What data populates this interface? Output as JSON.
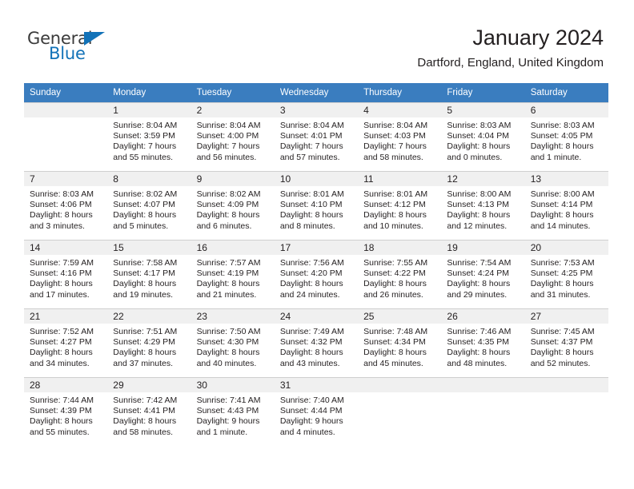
{
  "brand": {
    "name_part1": "General",
    "name_part2": "Blue",
    "accent_color": "#1272b8"
  },
  "header": {
    "title": "January 2024",
    "subtitle": "Dartford, England, United Kingdom"
  },
  "calendar": {
    "header_bg": "#3a7dbf",
    "daynum_bg": "#f0f0f0",
    "weekday_headers": [
      "Sunday",
      "Monday",
      "Tuesday",
      "Wednesday",
      "Thursday",
      "Friday",
      "Saturday"
    ],
    "weeks": [
      [
        {
          "day": "",
          "lines": []
        },
        {
          "day": "1",
          "lines": [
            "Sunrise: 8:04 AM",
            "Sunset: 3:59 PM",
            "Daylight: 7 hours",
            "and 55 minutes."
          ]
        },
        {
          "day": "2",
          "lines": [
            "Sunrise: 8:04 AM",
            "Sunset: 4:00 PM",
            "Daylight: 7 hours",
            "and 56 minutes."
          ]
        },
        {
          "day": "3",
          "lines": [
            "Sunrise: 8:04 AM",
            "Sunset: 4:01 PM",
            "Daylight: 7 hours",
            "and 57 minutes."
          ]
        },
        {
          "day": "4",
          "lines": [
            "Sunrise: 8:04 AM",
            "Sunset: 4:03 PM",
            "Daylight: 7 hours",
            "and 58 minutes."
          ]
        },
        {
          "day": "5",
          "lines": [
            "Sunrise: 8:03 AM",
            "Sunset: 4:04 PM",
            "Daylight: 8 hours",
            "and 0 minutes."
          ]
        },
        {
          "day": "6",
          "lines": [
            "Sunrise: 8:03 AM",
            "Sunset: 4:05 PM",
            "Daylight: 8 hours",
            "and 1 minute."
          ]
        }
      ],
      [
        {
          "day": "7",
          "lines": [
            "Sunrise: 8:03 AM",
            "Sunset: 4:06 PM",
            "Daylight: 8 hours",
            "and 3 minutes."
          ]
        },
        {
          "day": "8",
          "lines": [
            "Sunrise: 8:02 AM",
            "Sunset: 4:07 PM",
            "Daylight: 8 hours",
            "and 5 minutes."
          ]
        },
        {
          "day": "9",
          "lines": [
            "Sunrise: 8:02 AM",
            "Sunset: 4:09 PM",
            "Daylight: 8 hours",
            "and 6 minutes."
          ]
        },
        {
          "day": "10",
          "lines": [
            "Sunrise: 8:01 AM",
            "Sunset: 4:10 PM",
            "Daylight: 8 hours",
            "and 8 minutes."
          ]
        },
        {
          "day": "11",
          "lines": [
            "Sunrise: 8:01 AM",
            "Sunset: 4:12 PM",
            "Daylight: 8 hours",
            "and 10 minutes."
          ]
        },
        {
          "day": "12",
          "lines": [
            "Sunrise: 8:00 AM",
            "Sunset: 4:13 PM",
            "Daylight: 8 hours",
            "and 12 minutes."
          ]
        },
        {
          "day": "13",
          "lines": [
            "Sunrise: 8:00 AM",
            "Sunset: 4:14 PM",
            "Daylight: 8 hours",
            "and 14 minutes."
          ]
        }
      ],
      [
        {
          "day": "14",
          "lines": [
            "Sunrise: 7:59 AM",
            "Sunset: 4:16 PM",
            "Daylight: 8 hours",
            "and 17 minutes."
          ]
        },
        {
          "day": "15",
          "lines": [
            "Sunrise: 7:58 AM",
            "Sunset: 4:17 PM",
            "Daylight: 8 hours",
            "and 19 minutes."
          ]
        },
        {
          "day": "16",
          "lines": [
            "Sunrise: 7:57 AM",
            "Sunset: 4:19 PM",
            "Daylight: 8 hours",
            "and 21 minutes."
          ]
        },
        {
          "day": "17",
          "lines": [
            "Sunrise: 7:56 AM",
            "Sunset: 4:20 PM",
            "Daylight: 8 hours",
            "and 24 minutes."
          ]
        },
        {
          "day": "18",
          "lines": [
            "Sunrise: 7:55 AM",
            "Sunset: 4:22 PM",
            "Daylight: 8 hours",
            "and 26 minutes."
          ]
        },
        {
          "day": "19",
          "lines": [
            "Sunrise: 7:54 AM",
            "Sunset: 4:24 PM",
            "Daylight: 8 hours",
            "and 29 minutes."
          ]
        },
        {
          "day": "20",
          "lines": [
            "Sunrise: 7:53 AM",
            "Sunset: 4:25 PM",
            "Daylight: 8 hours",
            "and 31 minutes."
          ]
        }
      ],
      [
        {
          "day": "21",
          "lines": [
            "Sunrise: 7:52 AM",
            "Sunset: 4:27 PM",
            "Daylight: 8 hours",
            "and 34 minutes."
          ]
        },
        {
          "day": "22",
          "lines": [
            "Sunrise: 7:51 AM",
            "Sunset: 4:29 PM",
            "Daylight: 8 hours",
            "and 37 minutes."
          ]
        },
        {
          "day": "23",
          "lines": [
            "Sunrise: 7:50 AM",
            "Sunset: 4:30 PM",
            "Daylight: 8 hours",
            "and 40 minutes."
          ]
        },
        {
          "day": "24",
          "lines": [
            "Sunrise: 7:49 AM",
            "Sunset: 4:32 PM",
            "Daylight: 8 hours",
            "and 43 minutes."
          ]
        },
        {
          "day": "25",
          "lines": [
            "Sunrise: 7:48 AM",
            "Sunset: 4:34 PM",
            "Daylight: 8 hours",
            "and 45 minutes."
          ]
        },
        {
          "day": "26",
          "lines": [
            "Sunrise: 7:46 AM",
            "Sunset: 4:35 PM",
            "Daylight: 8 hours",
            "and 48 minutes."
          ]
        },
        {
          "day": "27",
          "lines": [
            "Sunrise: 7:45 AM",
            "Sunset: 4:37 PM",
            "Daylight: 8 hours",
            "and 52 minutes."
          ]
        }
      ],
      [
        {
          "day": "28",
          "lines": [
            "Sunrise: 7:44 AM",
            "Sunset: 4:39 PM",
            "Daylight: 8 hours",
            "and 55 minutes."
          ]
        },
        {
          "day": "29",
          "lines": [
            "Sunrise: 7:42 AM",
            "Sunset: 4:41 PM",
            "Daylight: 8 hours",
            "and 58 minutes."
          ]
        },
        {
          "day": "30",
          "lines": [
            "Sunrise: 7:41 AM",
            "Sunset: 4:43 PM",
            "Daylight: 9 hours",
            "and 1 minute."
          ]
        },
        {
          "day": "31",
          "lines": [
            "Sunrise: 7:40 AM",
            "Sunset: 4:44 PM",
            "Daylight: 9 hours",
            "and 4 minutes."
          ]
        },
        {
          "day": "",
          "lines": []
        },
        {
          "day": "",
          "lines": []
        },
        {
          "day": "",
          "lines": []
        }
      ]
    ]
  }
}
